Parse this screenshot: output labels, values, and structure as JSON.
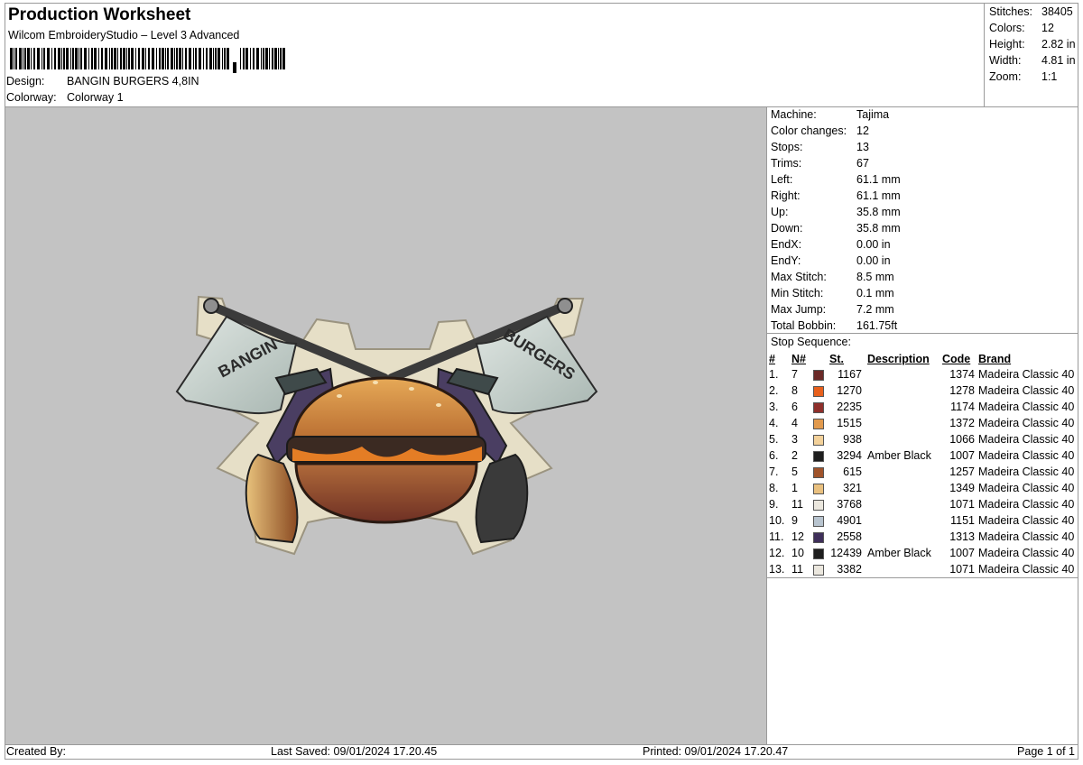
{
  "header": {
    "title": "Production Worksheet",
    "subtitle": "Wilcom EmbroideryStudio – Level 3 Advanced",
    "design_label": "Design:",
    "design_value": "BANGIN BURGERS 4,8IN",
    "colorway_label": "Colorway:",
    "colorway_value": "Colorway 1"
  },
  "summary": {
    "stitches_label": "Stitches:",
    "stitches": "38405",
    "colors_label": "Colors:",
    "colors": "12",
    "height_label": "Height:",
    "height": "2.82 in",
    "width_label": "Width:",
    "width": "4.81 in",
    "zoom_label": "Zoom:",
    "zoom": "1:1"
  },
  "machine": [
    {
      "label": "Machine:",
      "value": "Tajima"
    },
    {
      "label": "Color changes:",
      "value": "12"
    },
    {
      "label": "Stops:",
      "value": "13"
    },
    {
      "label": "Trims:",
      "value": "67"
    },
    {
      "label": "Left:",
      "value": "61.1 mm"
    },
    {
      "label": "Right:",
      "value": "61.1 mm"
    },
    {
      "label": "Up:",
      "value": "35.8 mm"
    },
    {
      "label": "Down:",
      "value": "35.8 mm"
    },
    {
      "label": "EndX:",
      "value": "0.00 in"
    },
    {
      "label": "EndY:",
      "value": "0.00 in"
    },
    {
      "label": "Max Stitch:",
      "value": "8.5 mm"
    },
    {
      "label": "Min Stitch:",
      "value": "0.1 mm"
    },
    {
      "label": "Max Jump:",
      "value": "7.2 mm"
    },
    {
      "label": "Total Bobbin:",
      "value": "161.75ft"
    }
  ],
  "stop_sequence": {
    "title": "Stop Sequence:",
    "headers": {
      "idx": "#",
      "n": "N#",
      "st": "St.",
      "desc": "Description",
      "code": "Code",
      "brand": "Brand"
    },
    "rows": [
      {
        "idx": "1.",
        "n": "7",
        "color": "#6b2a28",
        "st": "1167",
        "desc": "",
        "code": "1374",
        "brand": "Madeira Classic 40"
      },
      {
        "idx": "2.",
        "n": "8",
        "color": "#e8601c",
        "st": "1270",
        "desc": "",
        "code": "1278",
        "brand": "Madeira Classic 40"
      },
      {
        "idx": "3.",
        "n": "6",
        "color": "#8f2f2b",
        "st": "2235",
        "desc": "",
        "code": "1174",
        "brand": "Madeira Classic 40"
      },
      {
        "idx": "4.",
        "n": "4",
        "color": "#e29a4d",
        "st": "1515",
        "desc": "",
        "code": "1372",
        "brand": "Madeira Classic 40"
      },
      {
        "idx": "5.",
        "n": "3",
        "color": "#f3d19a",
        "st": "938",
        "desc": "",
        "code": "1066",
        "brand": "Madeira Classic 40"
      },
      {
        "idx": "6.",
        "n": "2",
        "color": "#1e1e1e",
        "st": "3294",
        "desc": "Amber Black",
        "code": "1007",
        "brand": "Madeira Classic 40"
      },
      {
        "idx": "7.",
        "n": "5",
        "color": "#a0532a",
        "st": "615",
        "desc": "",
        "code": "1257",
        "brand": "Madeira Classic 40"
      },
      {
        "idx": "8.",
        "n": "1",
        "color": "#e9c07f",
        "st": "321",
        "desc": "",
        "code": "1349",
        "brand": "Madeira Classic 40"
      },
      {
        "idx": "9.",
        "n": "11",
        "color": "#ebe7de",
        "st": "3768",
        "desc": "",
        "code": "1071",
        "brand": "Madeira Classic 40"
      },
      {
        "idx": "10.",
        "n": "9",
        "color": "#b8c4cf",
        "st": "4901",
        "desc": "",
        "code": "1151",
        "brand": "Madeira Classic 40"
      },
      {
        "idx": "11.",
        "n": "12",
        "color": "#3f2f5a",
        "st": "2558",
        "desc": "",
        "code": "1313",
        "brand": "Madeira Classic 40"
      },
      {
        "idx": "12.",
        "n": "10",
        "color": "#1e1e1e",
        "st": "12439",
        "desc": "Amber Black",
        "code": "1007",
        "brand": "Madeira Classic 40"
      },
      {
        "idx": "13.",
        "n": "11",
        "color": "#ebe7de",
        "st": "3382",
        "desc": "",
        "code": "1071",
        "brand": "Madeira Classic 40"
      }
    ]
  },
  "design_preview": {
    "left_flag_text": "BANGIN",
    "right_flag_text": "BURGERS"
  },
  "footer": {
    "created_by": "Created By:",
    "last_saved": "Last Saved: 09/01/2024 17.20.45",
    "printed": "Printed: 09/01/2024 17.20.47",
    "page": "Page 1 of 1"
  }
}
